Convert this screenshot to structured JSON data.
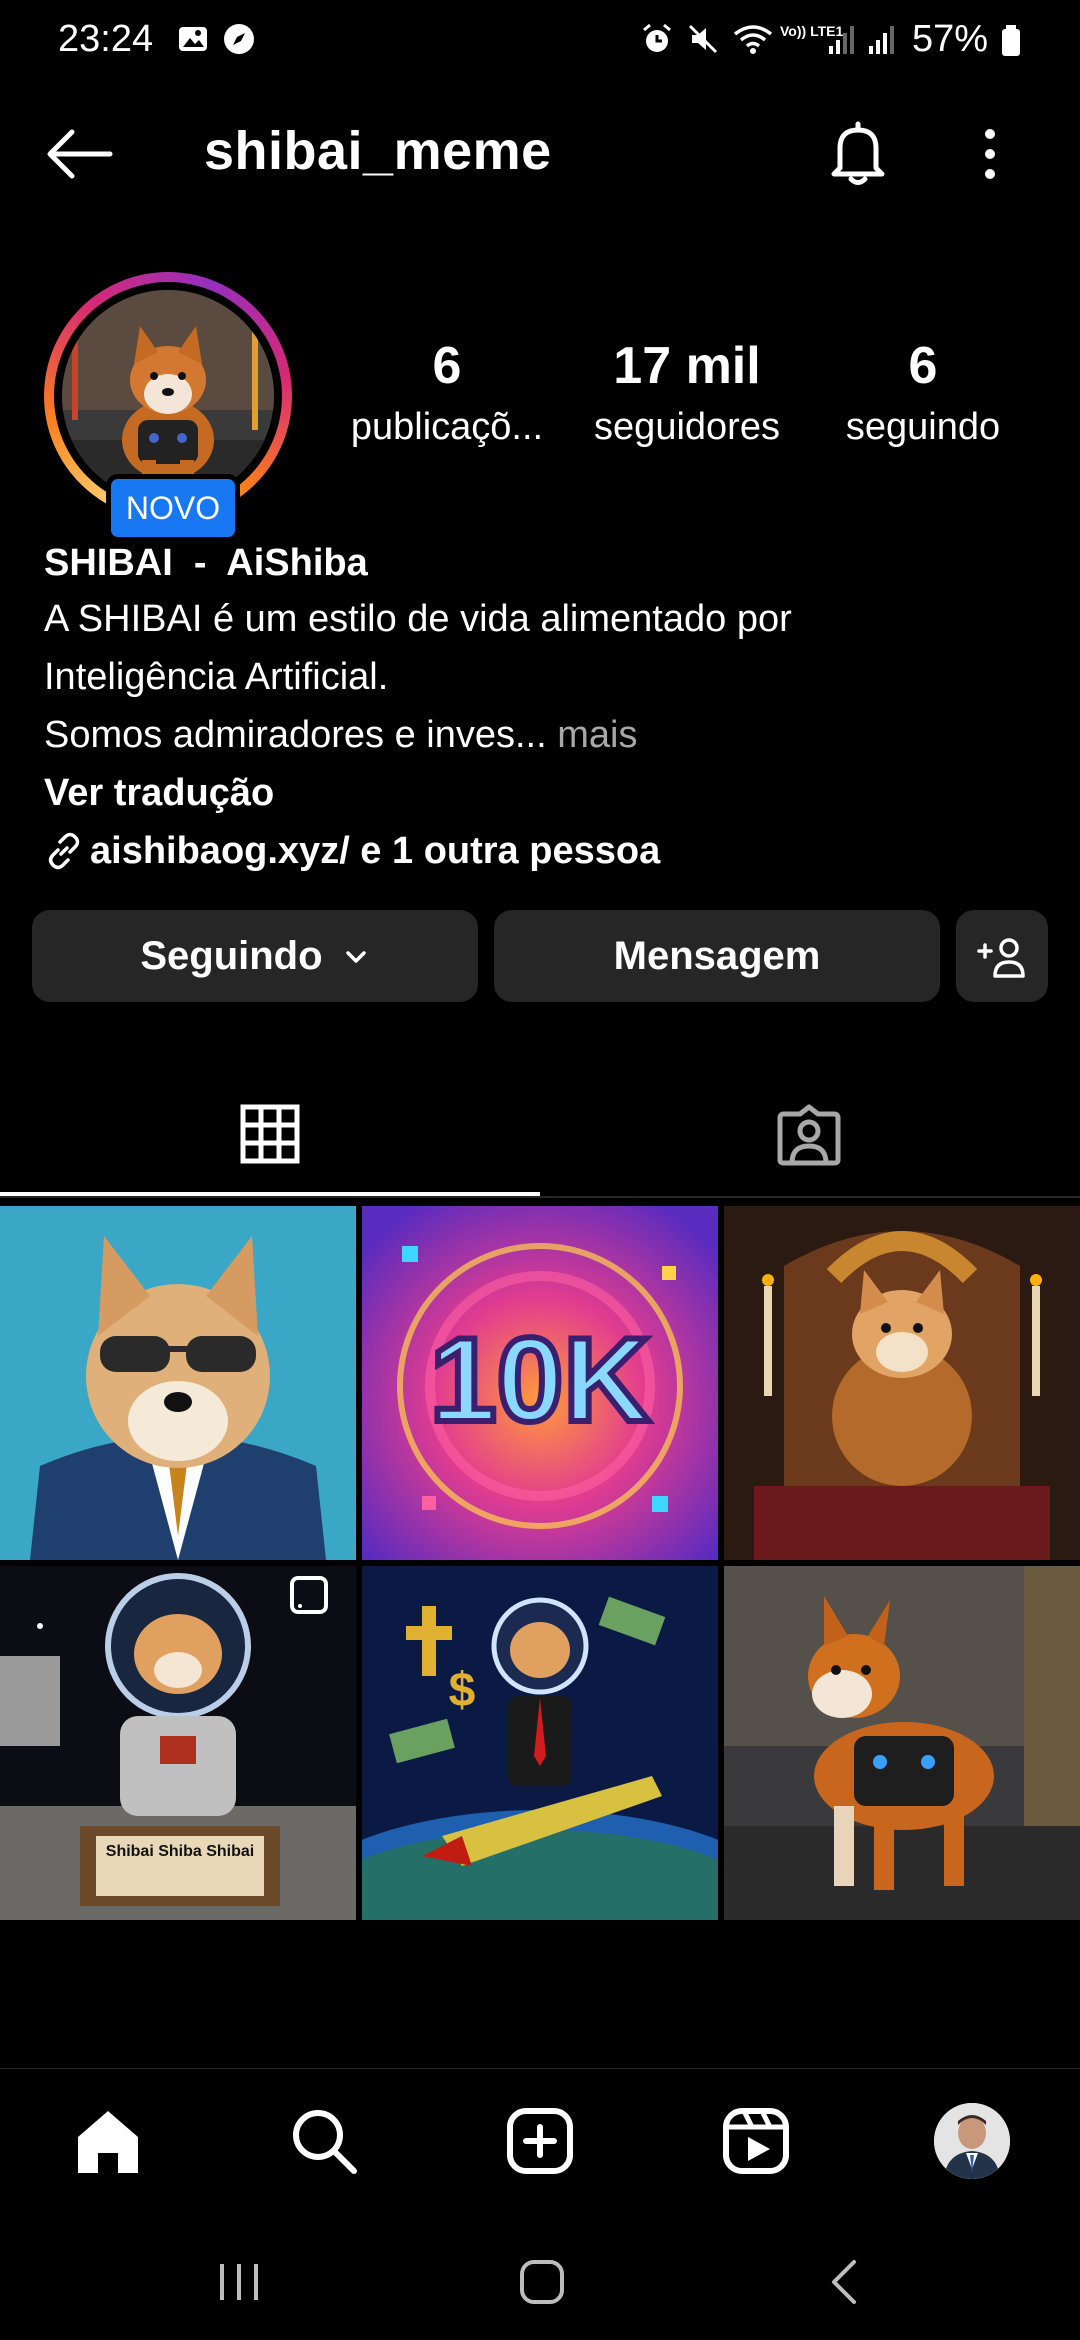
{
  "status_bar": {
    "time": "23:24",
    "battery": "57%",
    "network": "Vo)) LTE1"
  },
  "header": {
    "username": "shibai_meme"
  },
  "profile": {
    "badge": "NOVO",
    "stats": [
      {
        "value": "6",
        "label": "publicaçõ..."
      },
      {
        "value": "17 mil",
        "label": "seguidores"
      },
      {
        "value": "6",
        "label": "seguindo"
      }
    ],
    "name": "SHIBAI  -  AiShiba",
    "bio_line1": "A SHIBAI é um estilo de vida alimentado por",
    "bio_line2": "Inteligência Artificial.",
    "bio_line3": "Somos admiradores e inves...",
    "more": " mais",
    "translate": "Ver tradução",
    "link": "aishibaog.xyz/ e 1 outra pessoa"
  },
  "actions": {
    "following": "Seguindo",
    "message": "Mensagem"
  },
  "grid": {
    "posts": [
      {
        "caption": ""
      },
      {
        "caption": "10K"
      },
      {
        "caption": ""
      },
      {
        "caption": "Shibai Shiba Shibai"
      },
      {
        "caption": "$"
      },
      {
        "caption": ""
      }
    ]
  },
  "colors": {
    "background": "#000000",
    "button": "#262626",
    "badge": "#1877f2",
    "muted": "#a8a8a8"
  },
  "icons": [
    "back-arrow-icon",
    "bell-icon",
    "more-vert-icon",
    "grid-icon",
    "tagged-icon",
    "home-icon",
    "search-icon",
    "create-icon",
    "reels-icon",
    "profile-avatar"
  ]
}
